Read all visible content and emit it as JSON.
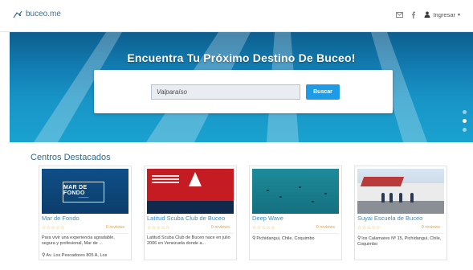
{
  "brand": {
    "name": "buceo.me"
  },
  "nav": {
    "login_label": "Ingresar"
  },
  "hero": {
    "title": "Encuentra Tu Próximo Destino De Buceo!",
    "search_value": "Valparaíso",
    "search_button": "Buscar",
    "slides_count": 3,
    "active_slide": 2
  },
  "section": {
    "title": "Centros Destacados"
  },
  "cards": [
    {
      "name": "Mar de Fondo",
      "thumb_text": "MAR DE FONDO",
      "stars": "☆☆☆☆☆",
      "reviews": "0 reviews",
      "description": "Para vivir una experiencia agradable, segura y profesional, Mar de ...",
      "location": "Av. Los Pescadores 805 A, Los"
    },
    {
      "name": "Latitud Scuba Club de Buceo",
      "stars": "☆☆☆☆☆",
      "reviews": "0 reviews",
      "description": "Latitud Scuba Club de Buceo nace en julio 2006 en Venezuela donde a...",
      "location": ""
    },
    {
      "name": "Deep Wave",
      "stars": "☆☆☆☆☆",
      "reviews": "0 reviews",
      "description": "",
      "location": "Pichidangui, Chile, Coquimbo"
    },
    {
      "name": "Suyai Escuela de Buceo",
      "stars": "☆☆☆☆☆",
      "reviews": "0 reviews",
      "description": "",
      "location": "los Calamares Nº 15, Pichidangui, Chile, Coquimbo"
    }
  ],
  "colors": {
    "accent": "#1e9be6",
    "link": "#2f8fd0",
    "star": "#e8b04a",
    "hero_top": "#0d5e8e",
    "hero_bottom": "#1aa2cf"
  },
  "icons": [
    "diver-logo-icon",
    "mail-icon",
    "facebook-icon",
    "user-icon",
    "chevron-down-icon",
    "map-pin-icon"
  ]
}
